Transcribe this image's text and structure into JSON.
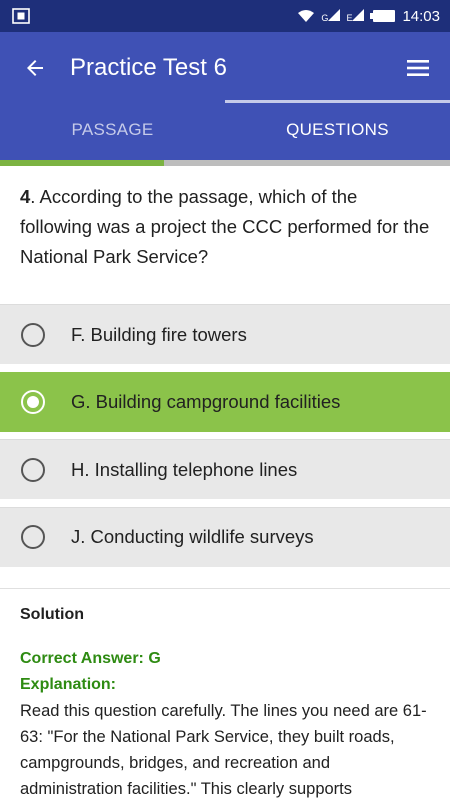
{
  "status_bar": {
    "time": "14:03",
    "screenshot_icon": "screenshot-icon",
    "wifi_icon": "wifi-icon",
    "signal_icons": [
      "signal-g-icon",
      "signal-e-icon"
    ],
    "signal_g_label": "G",
    "signal_e_label": "E",
    "battery_icon": "battery-icon"
  },
  "app_bar": {
    "title": "Practice Test 6",
    "back_icon": "arrow-back-icon",
    "menu_icon": "hamburger-menu-icon",
    "color": "#3f51b5"
  },
  "tabs": [
    {
      "label": "PASSAGE",
      "active": false
    },
    {
      "label": "QUESTIONS",
      "active": true
    }
  ],
  "progress": {
    "fraction": 0.364,
    "fill_color": "#7cb342"
  },
  "question": {
    "number": "4",
    "text": ". According to the passage, which of the following was a project the CCC performed for the National Park Service?"
  },
  "options": [
    {
      "label": "F. Building fire towers",
      "selected": false
    },
    {
      "label": "G. Building campground facilities",
      "selected": true
    },
    {
      "label": "H. Installing telephone lines",
      "selected": false
    },
    {
      "label": "J. Conducting wildlife surveys",
      "selected": false
    }
  ],
  "solution": {
    "heading": "Solution",
    "correct_answer": "Correct Answer: G",
    "explanation_label": "Explanation:",
    "explanation_text": "Read this question carefully. The lines you need are 61-63: \"For the National Park Service, they built roads, campgrounds, bridges, and recreation and administration facilities.\" This clearly supports",
    "accent_color": "#2e8b12"
  }
}
